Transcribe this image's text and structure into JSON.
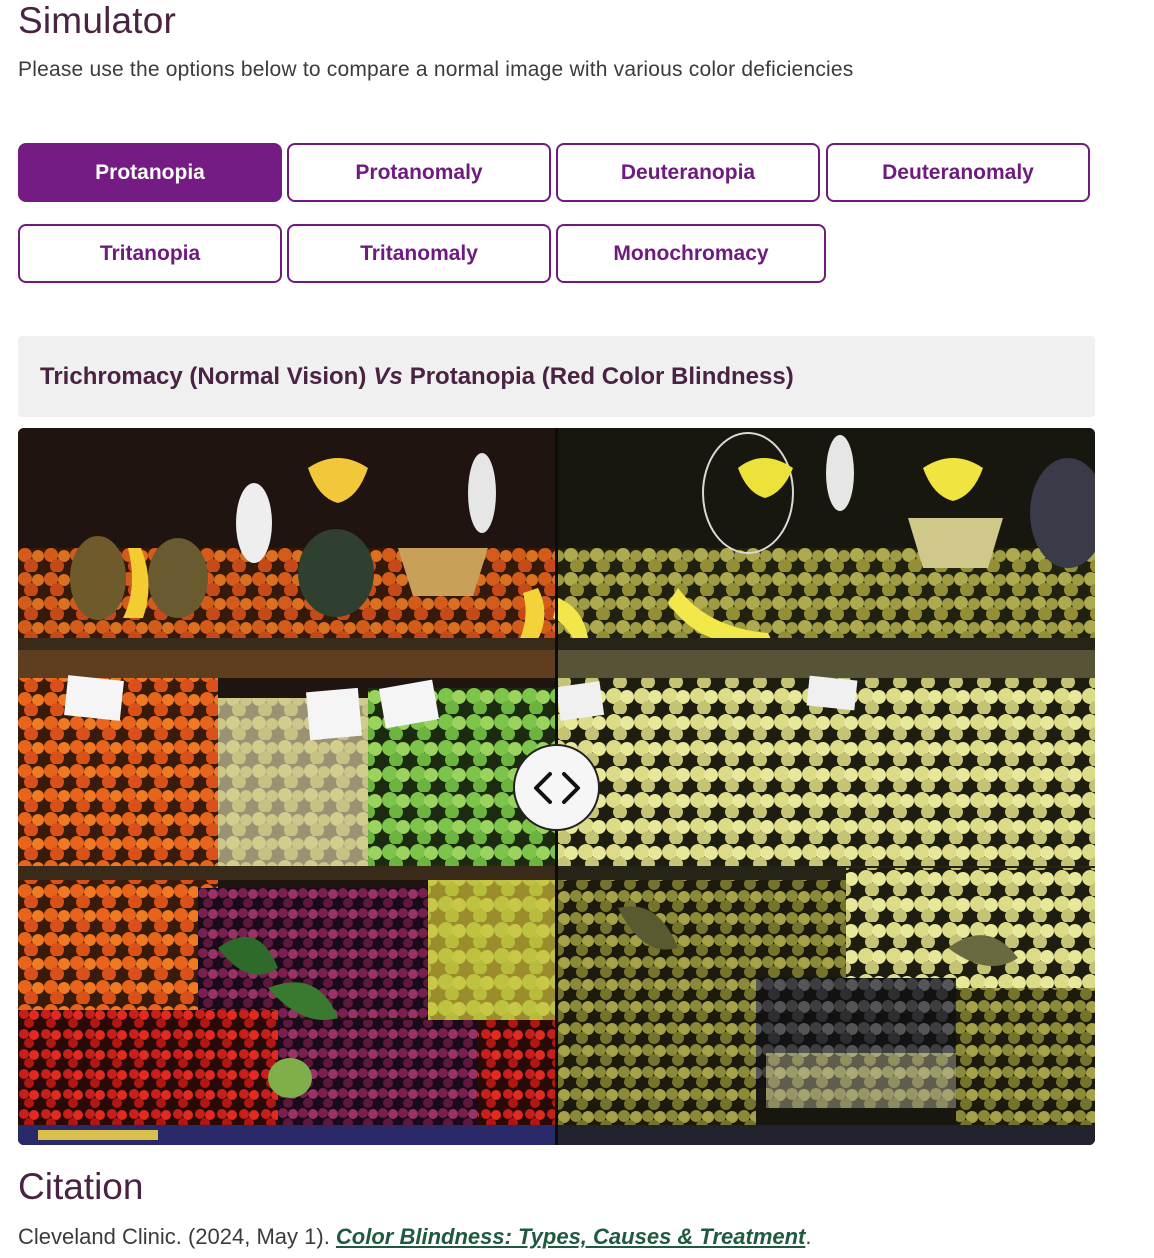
{
  "page": {
    "title": "Simulator",
    "subtitle": "Please use the options below to compare a normal image with various color deficiencies"
  },
  "options": [
    {
      "label": "Protanopia",
      "active": true
    },
    {
      "label": "Protanomaly",
      "active": false
    },
    {
      "label": "Deuteranopia",
      "active": false
    },
    {
      "label": "Deuteranomaly",
      "active": false
    },
    {
      "label": "Tritanopia",
      "active": false
    },
    {
      "label": "Tritanomaly",
      "active": false
    },
    {
      "label": "Monochromacy",
      "active": false
    }
  ],
  "comparison": {
    "left_label": "Trichromacy (Normal Vision)",
    "vs_label": "Vs",
    "right_label": "Protanopia (Red Color Blindness)"
  },
  "slider": {
    "icon": "chevron-left-right-icon"
  },
  "citation": {
    "heading": "Citation",
    "prefix": "Cleveland Clinic. (2024, May 1). ",
    "link_text": "Color Blindness: Types, Causes & Treatment",
    "suffix": "."
  },
  "colors": {
    "accent": "#751b84",
    "heading": "#4a2342",
    "link": "#1f5a3e"
  }
}
